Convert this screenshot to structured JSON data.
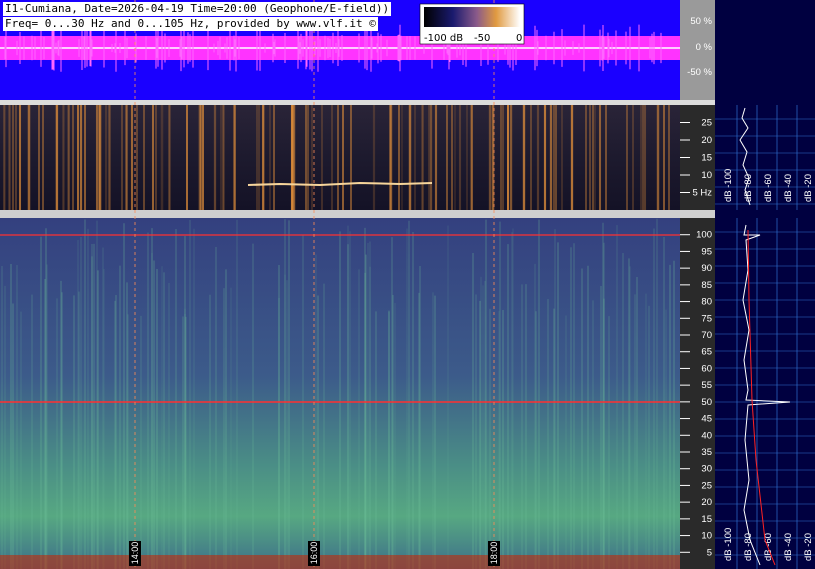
{
  "header": {
    "line1": "I1-Cumiana, Date=2026-04-19 Time=20:00 (Geophone/E-field))",
    "line2": "Freq= 0...30 Hz and 0...105 Hz, provided by www.vlf.it ©"
  },
  "colorbar": {
    "labels": [
      "-100 dB",
      "-50",
      "0"
    ]
  },
  "waveform": {
    "ticks": [
      "50 %",
      "0 %",
      "-50 %"
    ],
    "bg_color": "#1a00ff",
    "trace_color": "#ff33ff"
  },
  "spectrogram_low": {
    "ticks": [
      "25",
      "20",
      "15",
      "10",
      "5 Hz"
    ]
  },
  "spectrogram_high": {
    "ticks": [
      "100",
      "95",
      "90",
      "85",
      "80",
      "75",
      "70",
      "65",
      "60",
      "55",
      "50",
      "45",
      "40",
      "35",
      "30",
      "25",
      "20",
      "15",
      "10",
      "5"
    ]
  },
  "time_markers": [
    "14:00",
    "16:00",
    "18:00"
  ],
  "side_panel_low": {
    "labels": [
      "dB -100",
      "dB -80",
      "dB -60",
      "dB -40",
      "dB -20"
    ]
  },
  "side_panel_high": {
    "labels": [
      "dB -100",
      "dB -80",
      "dB -60",
      "dB -40",
      "dB -20"
    ]
  },
  "chart_data": [
    {
      "type": "line",
      "name": "waveform",
      "yticks": [
        "50 %",
        "0 %",
        "-50 %"
      ],
      "ylim": [
        -100,
        100
      ]
    },
    {
      "type": "heatmap",
      "name": "spectrogram 0-30 Hz",
      "ylabel": "Hz",
      "ylim": [
        0,
        30
      ],
      "yticks": [
        5,
        10,
        15,
        20,
        25
      ],
      "xticks": [
        "14:00",
        "16:00",
        "18:00"
      ]
    },
    {
      "type": "heatmap",
      "name": "spectrogram 0-105 Hz",
      "ylim": [
        0,
        105
      ],
      "yticks": [
        5,
        10,
        15,
        20,
        25,
        30,
        35,
        40,
        45,
        50,
        55,
        60,
        65,
        70,
        75,
        80,
        85,
        90,
        95,
        100
      ],
      "xticks": [
        "14:00",
        "16:00",
        "18:00"
      ],
      "horizontal_lines_hz": [
        50,
        100
      ]
    },
    {
      "type": "line",
      "name": "spectrum profile",
      "xlabel": "dB",
      "xticks": [
        -100,
        -80,
        -60,
        -40,
        -20
      ],
      "peaks_hz": [
        50,
        100
      ]
    }
  ]
}
